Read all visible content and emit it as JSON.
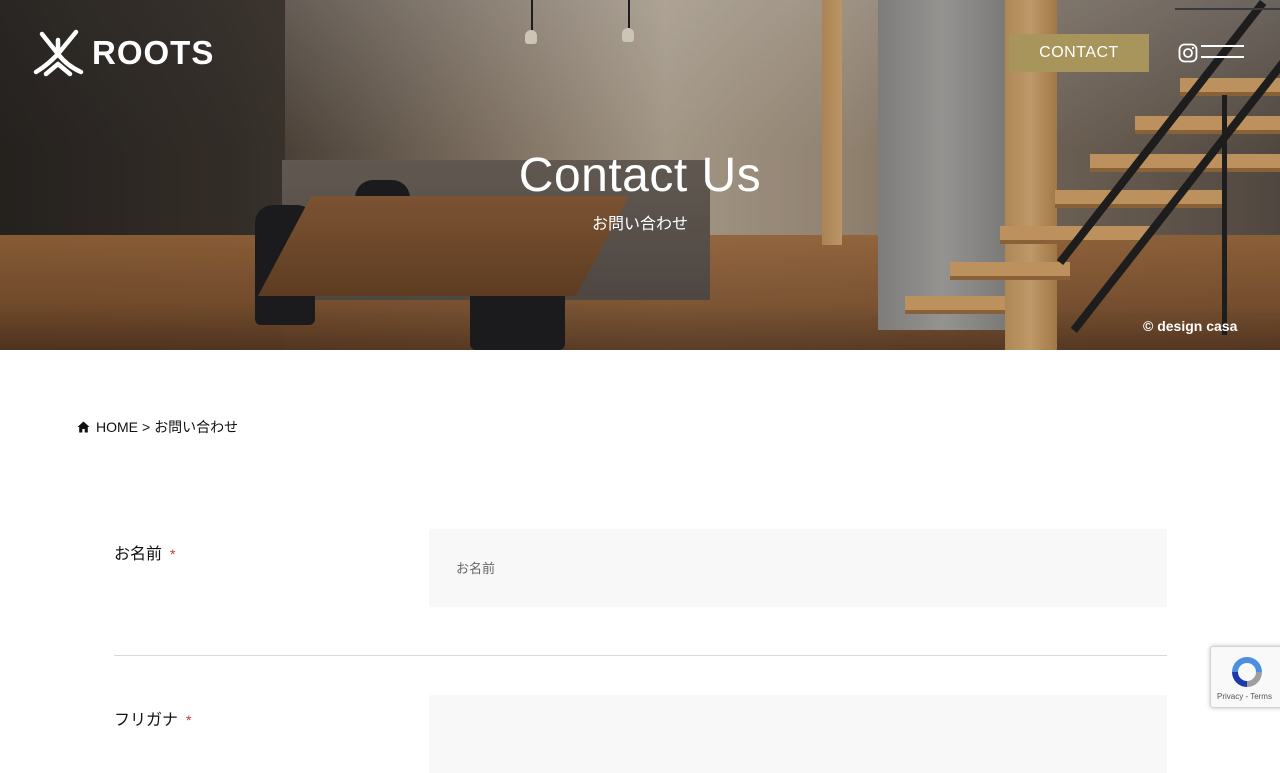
{
  "header": {
    "logo_text": "ROOTS",
    "contact_label": "CONTACT",
    "instagram_icon": "instagram-icon",
    "menu_icon": "hamburger-menu-icon"
  },
  "hero": {
    "title": "Contact Us",
    "subtitle": "お問い合わせ",
    "credit": "© design casa"
  },
  "breadcrumb": {
    "home_icon": "home-icon",
    "home_label": "HOME",
    "separator": ">",
    "current": "お問い合わせ"
  },
  "form": {
    "fields": [
      {
        "label": "お名前",
        "required_mark": "*",
        "placeholder": "お名前",
        "value": ""
      },
      {
        "label": "フリガナ",
        "required_mark": "*",
        "placeholder": "",
        "value": ""
      }
    ]
  },
  "recaptcha": {
    "terms_text": "Privacy - Terms"
  },
  "colors": {
    "accent": "#a7955b",
    "required": "#d0322f",
    "field_bg": "#f8f8f8"
  }
}
